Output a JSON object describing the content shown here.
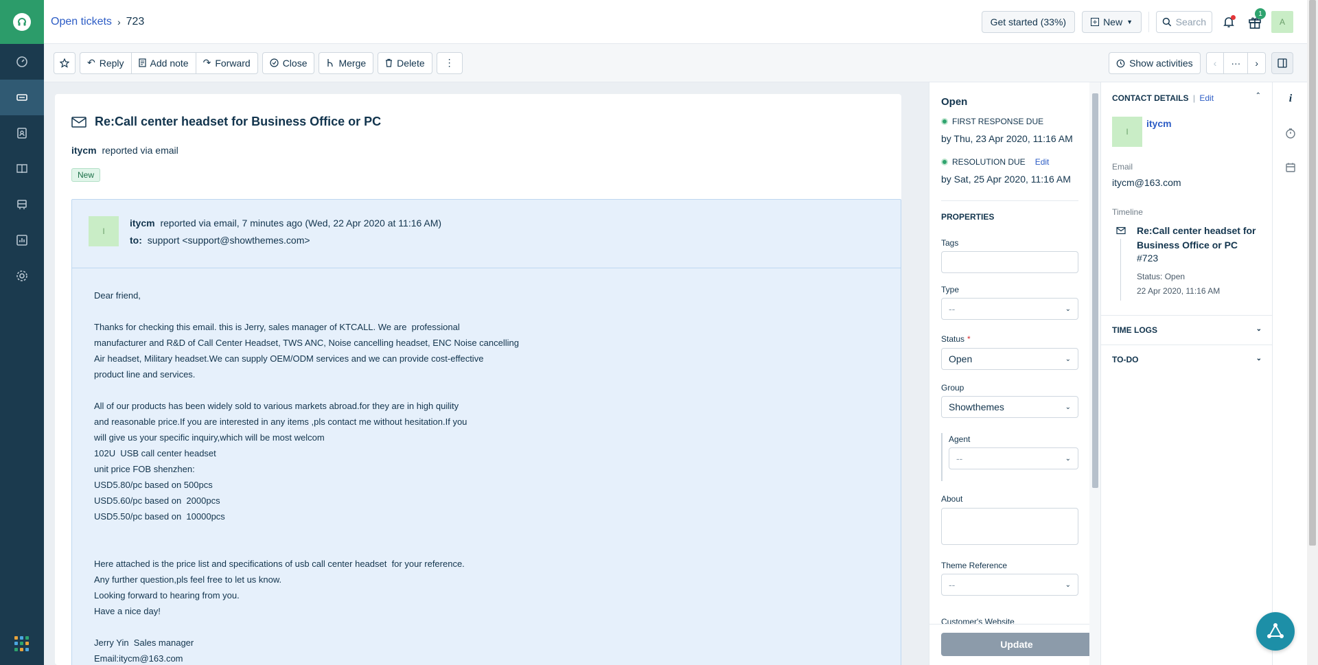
{
  "colors": {
    "nav_bg": "#1b3a4e",
    "brand_green": "#2c9c6a",
    "link_blue": "#2c5cc5",
    "conv_bg": "#e6f0fb",
    "success": "#2ea36e"
  },
  "nav": {
    "items": [
      {
        "name": "dashboard-icon",
        "active": false
      },
      {
        "name": "tickets-icon",
        "active": true
      },
      {
        "name": "contacts-icon",
        "active": false
      },
      {
        "name": "solutions-icon",
        "active": false
      },
      {
        "name": "forums-icon",
        "active": false
      },
      {
        "name": "reports-icon",
        "active": false
      },
      {
        "name": "admin-gear-icon",
        "active": false
      }
    ],
    "apps_icon": "apps-grid-icon"
  },
  "header": {
    "breadcrumb_link": "Open tickets",
    "breadcrumb_sep": "›",
    "ticket_number": "723",
    "get_started": "Get started (33%)",
    "new_label": "New",
    "search_placeholder": "Search",
    "gift_count": "1",
    "avatar_initial": "A"
  },
  "toolbar": {
    "reply": "Reply",
    "add_note": "Add note",
    "forward": "Forward",
    "close": "Close",
    "merge": "Merge",
    "delete": "Delete",
    "more": "⋮",
    "show_activities": "Show activities",
    "prev": "‹",
    "dots": "···",
    "next": "›"
  },
  "ticket": {
    "title": "Re:Call center headset for Business Office or PC",
    "requester": "itycm",
    "reported_via": "reported via email",
    "status_badge": "New",
    "conversation": {
      "avatar_initial": "I",
      "from": "itycm",
      "from_meta": "reported via email, 7 minutes ago (Wed, 22 Apr 2020 at 11:16 AM)",
      "to_label": "to:",
      "to_value": "support <support@showthemes.com>",
      "body_lines": [
        "Dear friend,",
        "",
        "Thanks for checking this email. this is Jerry, sales manager of KTCALL. We are  professional",
        "manufacturer and R&D of Call Center Headset, TWS ANC, Noise cancelling headset, ENC Noise cancelling",
        "Air headset, Military headset.We can supply OEM/ODM services and we can provide cost-effective",
        "product line and services.",
        "",
        "All of our products has been widely sold to various markets abroad.for they are in high quility",
        "and reasonable price.If you are interested in any items ,pls contact me without hesitation.If you",
        "will give us your specific inquiry,which will be most welcom",
        "102U  USB call center headset",
        "unit price FOB shenzhen:",
        "USD5.80/pc based on 500pcs",
        "USD5.60/pc based on  2000pcs",
        "USD5.50/pc based on  10000pcs",
        "",
        "",
        "Here attached is the price list and specifications of usb call center headset  for your reference.",
        "Any further question,pls feel free to let us know.",
        "Looking forward to hearing from you.",
        "Have a nice day!",
        "",
        "Jerry Yin  Sales manager",
        "Email:itycm@163.com"
      ]
    }
  },
  "properties": {
    "status_title": "Open",
    "first_response_label": "First response due",
    "first_response_value": "by Thu, 23 Apr 2020, 11:16 AM",
    "resolution_label": "Resolution due",
    "resolution_edit": "Edit",
    "resolution_value": "by Sat, 25 Apr 2020, 11:16 AM",
    "section_title": "Properties",
    "tags_label": "Tags",
    "type_label": "Type",
    "type_value": "--",
    "status_label": "Status",
    "status_required": "*",
    "status_value": "Open",
    "group_label": "Group",
    "group_value": "Showthemes",
    "agent_label": "Agent",
    "agent_value": "--",
    "about_label": "About",
    "theme_ref_label": "Theme Reference",
    "theme_ref_value": "--",
    "website_label": "Customer's Website",
    "update_button": "Update"
  },
  "contact": {
    "header": "Contact details",
    "sep": "|",
    "edit": "Edit",
    "avatar_initial": "I",
    "name": "itycm",
    "email_label": "Email",
    "email_value": "itycm@163.com",
    "timeline_label": "Timeline",
    "timeline_title": "Re:Call center headset for Business Office or PC",
    "timeline_id": "#723",
    "timeline_status": "Status: Open",
    "timeline_date": "22 Apr 2020, 11:16 AM",
    "time_logs": "Time logs",
    "todo": "To-do"
  }
}
